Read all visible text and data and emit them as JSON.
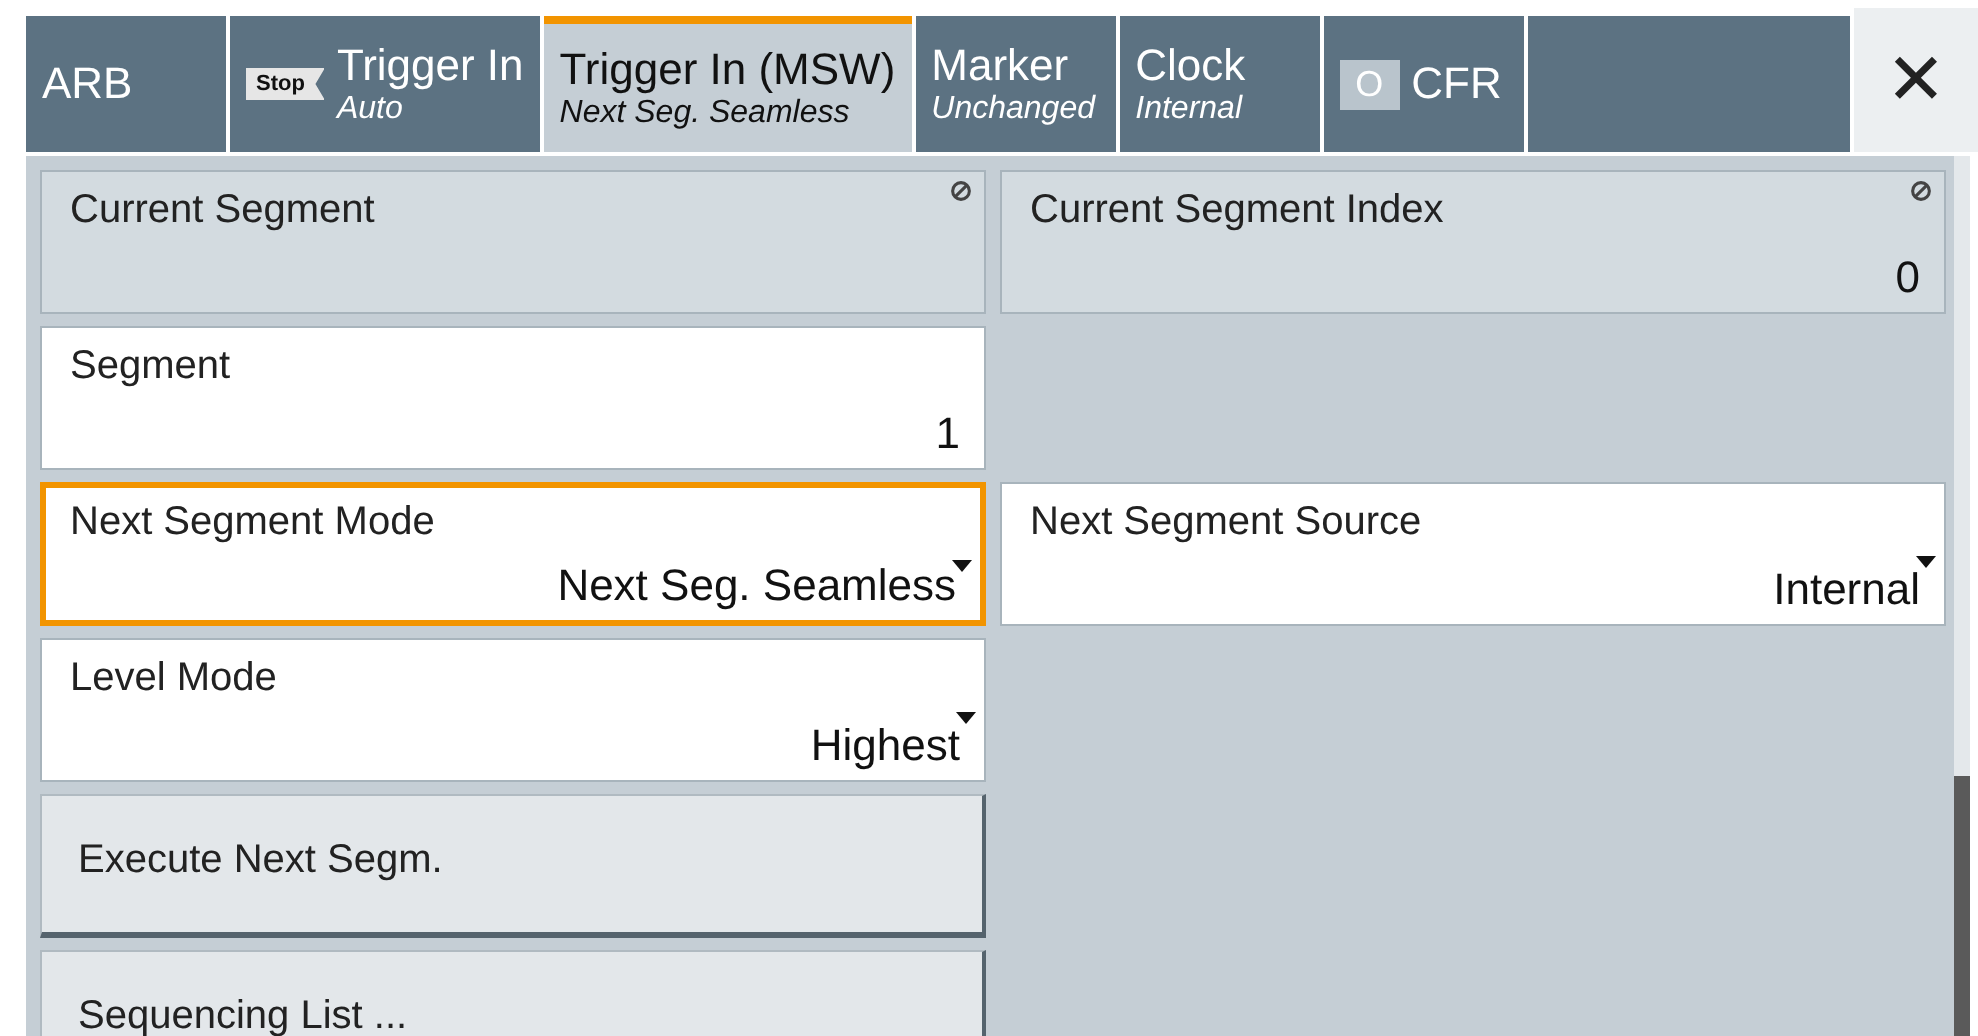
{
  "tabs": [
    {
      "kind": "plain",
      "label": "ARB",
      "selected": false
    },
    {
      "kind": "trigger",
      "badge": "Stop",
      "label": "Trigger In",
      "sub": "Auto",
      "selected": false
    },
    {
      "kind": "plain",
      "label": "Trigger In (MSW)",
      "sub": "Next Seg. Seamless",
      "selected": true
    },
    {
      "kind": "plain",
      "label": "Marker",
      "sub": "Unchanged",
      "selected": false
    },
    {
      "kind": "plain",
      "label": "Clock",
      "sub": "Internal",
      "selected": false
    },
    {
      "kind": "toggle",
      "badge": "O",
      "label": "CFR",
      "selected": false
    }
  ],
  "close": {
    "glyph": "✕"
  },
  "rows": [
    {
      "cells": [
        {
          "kind": "readonly",
          "label": "Current Segment",
          "focused": false
        },
        {
          "kind": "readonly",
          "label": "Current Segment Index",
          "value": "0",
          "focused": false
        }
      ]
    },
    {
      "cells": [
        {
          "kind": "input",
          "label": "Segment",
          "value": "1",
          "focused": false
        }
      ]
    },
    {
      "cells": [
        {
          "kind": "dropdown",
          "label": "Next Segment Mode",
          "value": "Next Seg. Seamless",
          "focused": true
        },
        {
          "kind": "dropdown",
          "label": "Next Segment Source",
          "value": "Internal",
          "focused": false
        }
      ]
    },
    {
      "cells": [
        {
          "kind": "dropdown",
          "label": "Level Mode",
          "value": "Highest",
          "focused": false
        }
      ]
    },
    {
      "cells": [
        {
          "kind": "button",
          "label": "Execute Next Segm.",
          "focused": false
        }
      ]
    },
    {
      "cells": [
        {
          "kind": "button",
          "label": "Sequencing List ...",
          "focused": false
        }
      ]
    }
  ]
}
